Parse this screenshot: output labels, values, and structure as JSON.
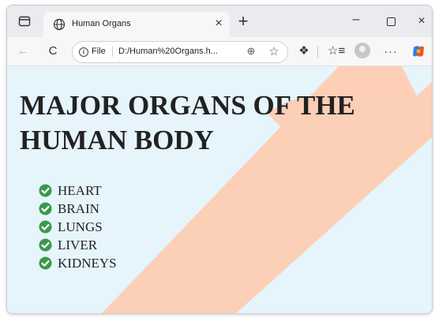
{
  "browser": {
    "tab": {
      "title": "Human Organs",
      "close_glyph": "×"
    },
    "new_tab_glyph": "+",
    "window_controls": {
      "minimize_glyph": "–",
      "close_glyph": "×"
    },
    "toolbar": {
      "back_glyph": "←",
      "refresh_glyph": "C",
      "info_glyph": "i",
      "file_label": "File",
      "url": "D:/Human%20Organs.h...",
      "zoom_glyph": "⊕",
      "favorite_glyph": "☆",
      "extensions_glyph": "❖",
      "favorites_glyph": "☆≡",
      "more_glyph": "···"
    }
  },
  "page": {
    "heading": "MAJOR ORGANS OF THE HUMAN BODY",
    "organs": [
      "HEART",
      "BRAIN",
      "LUNGS",
      "LIVER",
      "KIDNEYS"
    ]
  },
  "colors": {
    "content_background": "#e6f4fb",
    "check_icon": "#3a9a4a",
    "watermark": "#ffcbb0"
  },
  "icons": [
    "window-menu-icon",
    "globe-icon",
    "close-icon",
    "plus-icon",
    "back-arrow-icon",
    "refresh-icon",
    "info-icon",
    "zoom-icon",
    "favorite-star-icon",
    "extensions-icon",
    "favorites-icon",
    "profile-icon",
    "more-icon",
    "copilot-icon",
    "check-icon"
  ]
}
